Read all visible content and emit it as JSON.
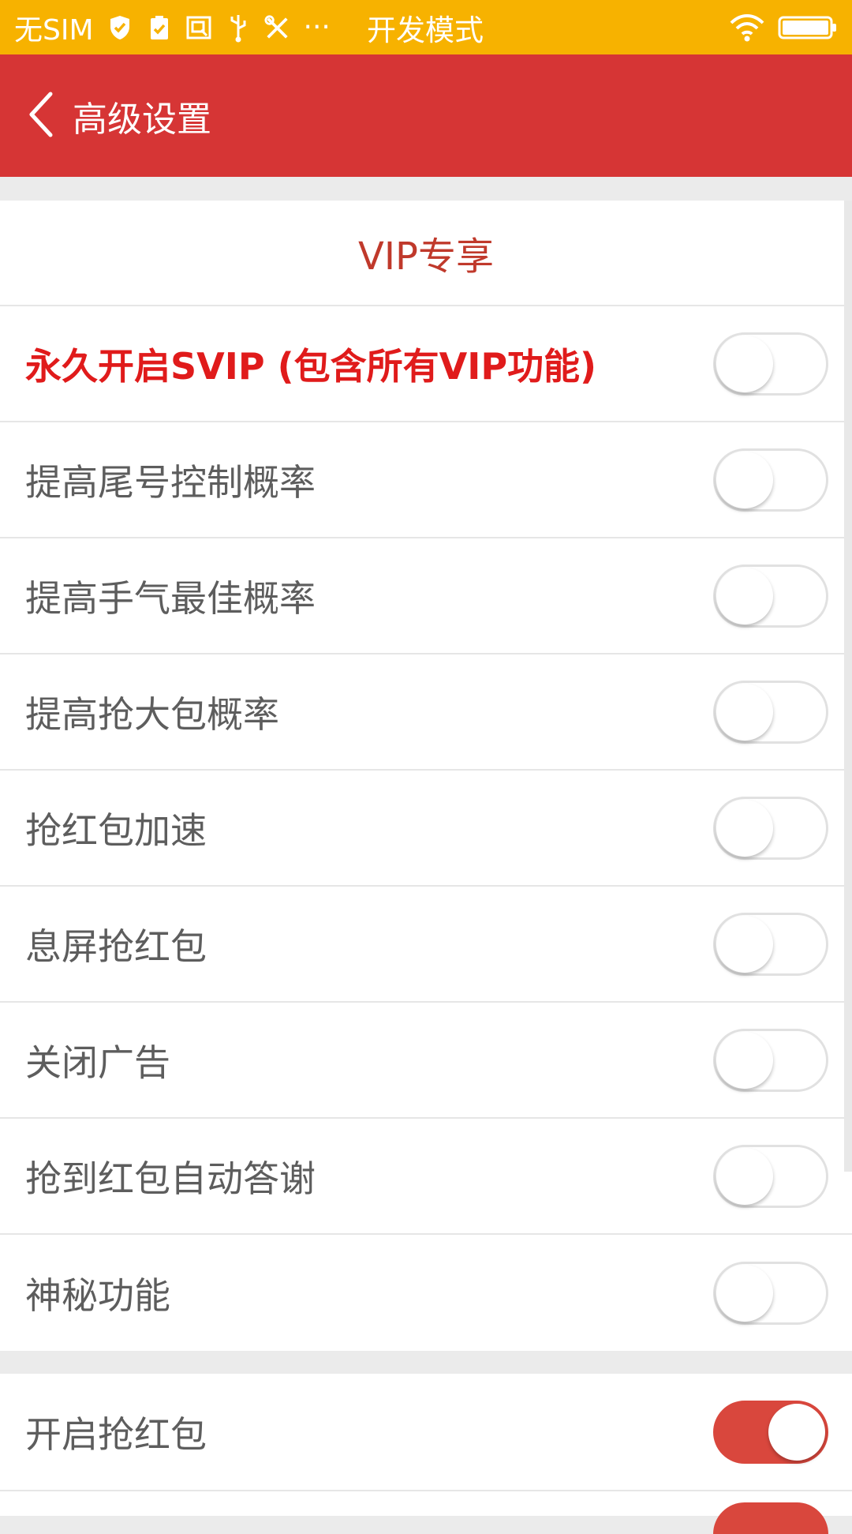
{
  "status_bar": {
    "carrier": "无SIM",
    "more": "···",
    "mode": "开发模式",
    "icons": [
      "shield-icon",
      "clipboard-check-icon",
      "screenshot-icon",
      "usb-icon",
      "tools-icon"
    ],
    "right_icons": [
      "wifi-icon",
      "battery-icon"
    ],
    "color": "#f7b200"
  },
  "header": {
    "title": "高级设置",
    "color": "#d63535"
  },
  "vip_section": {
    "title": "VIP专享",
    "rows": [
      {
        "label": "永久开启SVIP (包含所有VIP功能)",
        "on": false,
        "highlight": true
      },
      {
        "label": "提高尾号控制概率",
        "on": false
      },
      {
        "label": "提高手气最佳概率",
        "on": false
      },
      {
        "label": "提高抢大包概率",
        "on": false
      },
      {
        "label": "抢红包加速",
        "on": false
      },
      {
        "label": "息屏抢红包",
        "on": false
      },
      {
        "label": "关闭广告",
        "on": false
      },
      {
        "label": "抢到红包自动答谢",
        "on": false
      },
      {
        "label": "神秘功能",
        "on": false
      }
    ]
  },
  "main_section": {
    "rows": [
      {
        "label": "开启抢红包",
        "on": true
      }
    ]
  },
  "colors": {
    "toggle_on": "#d9473d",
    "highlight_text": "#e01b1b",
    "section_title": "#c0392b"
  }
}
